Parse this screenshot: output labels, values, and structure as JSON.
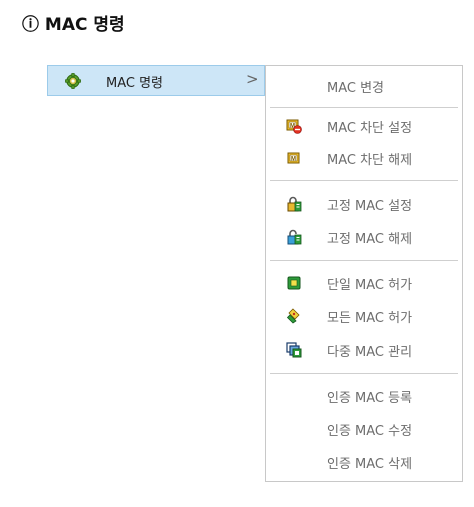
{
  "heading": {
    "marker": "ⓘ",
    "title": "MAC 명령"
  },
  "parent_menu": {
    "label": "MAC 명령",
    "icon": "gear-icon",
    "chevron": ">"
  },
  "submenu": {
    "items": [
      {
        "label": "MAC 변경",
        "icon": null
      },
      {
        "label": "MAC 차단 설정",
        "icon": "mac-block-set-icon"
      },
      {
        "label": "MAC 차단 해제",
        "icon": "mac-block-release-icon"
      },
      {
        "label": "고정 MAC 설정",
        "icon": "fixed-mac-set-icon"
      },
      {
        "label": "고정 MAC 해제",
        "icon": "fixed-mac-release-icon"
      },
      {
        "label": "단일 MAC 허가",
        "icon": "single-mac-allow-icon"
      },
      {
        "label": "모든 MAC 허가",
        "icon": "all-mac-allow-icon"
      },
      {
        "label": "다중 MAC 관리",
        "icon": "multi-mac-manage-icon"
      },
      {
        "label": "인증 MAC 등록",
        "icon": null
      },
      {
        "label": "인증 MAC 수정",
        "icon": null
      },
      {
        "label": "인증 MAC 삭제",
        "icon": null
      }
    ]
  },
  "colors": {
    "highlight_bg": "#cde6f7",
    "highlight_border": "#9ccbea",
    "menu_border": "#c8c8c8",
    "disabled_text": "#6d6d6d"
  }
}
